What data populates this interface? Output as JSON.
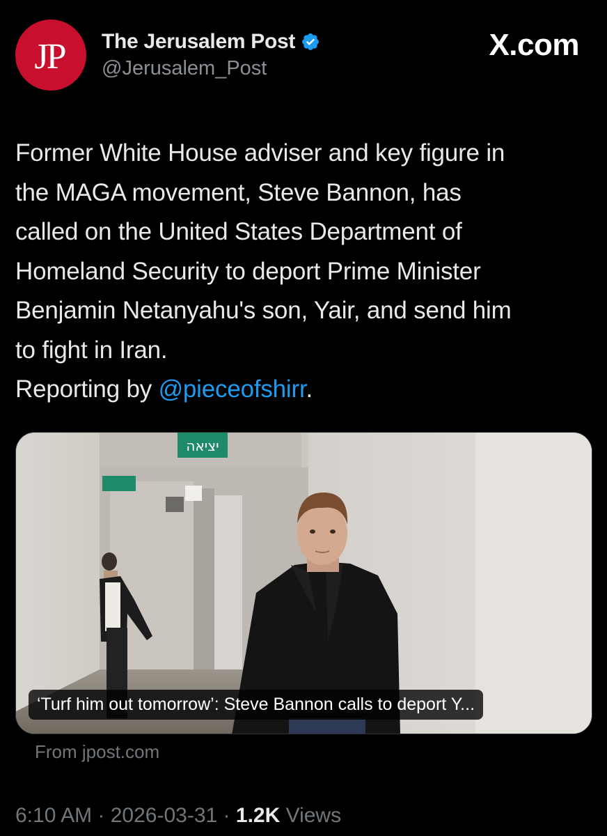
{
  "author": {
    "display_name": "The Jerusalem Post",
    "handle": "@Jerusalem_Post",
    "avatar_text": "JP",
    "avatar_color": "#c8102e",
    "verified_color": "#1d9bf0"
  },
  "brand": "X.com",
  "tweet": {
    "line_1": "Former White House adviser and key figure in",
    "line_2": "the MAGA movement, Steve Bannon, has",
    "line_3": "called on the United States Department of",
    "line_4": "Homeland Security to deport Prime Minister",
    "line_5": "Benjamin Netanyahu's son, Yair, and send him",
    "line_6": "to fight in Iran.",
    "reporting_prefix": "Reporting by ",
    "mention": "@pieceofshirr",
    "reporting_suffix": ".",
    "mention_color": "#1d9bf0"
  },
  "link_card": {
    "caption": "‘Turf him out tomorrow’: Steve Bannon calls to deport Y...",
    "source": "From jpost.com",
    "exit_sign_text": "יציאה"
  },
  "meta": {
    "time": "6:10 AM",
    "separator_1": " · ",
    "date": "2026-03-31",
    "separator_2": " · ",
    "views_count": "1.2K",
    "views_label": " Views"
  }
}
